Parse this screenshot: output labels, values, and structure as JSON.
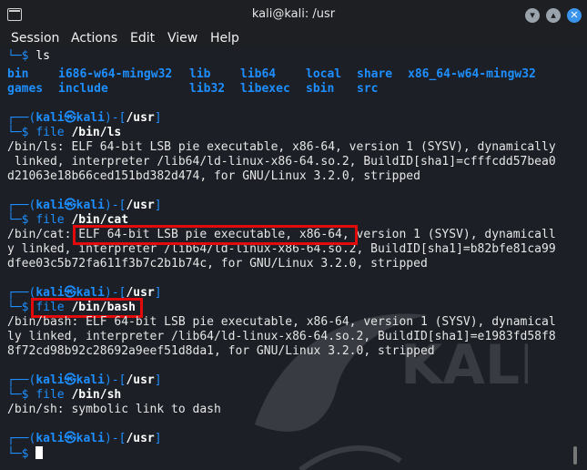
{
  "window": {
    "title": "kali@kali: /usr"
  },
  "menu": [
    "Session",
    "Actions",
    "Edit",
    "View",
    "Help"
  ],
  "ls": {
    "prompt_cont": "└─$ ",
    "cmd": "ls",
    "row1": [
      "bin",
      "i686-w64-mingw32",
      "lib",
      "lib64",
      "local",
      "share",
      "x86_64-w64-mingw32"
    ],
    "row2": [
      "games",
      "include",
      "lib32",
      "libexec",
      "sbin",
      "src"
    ]
  },
  "prompt": {
    "open": "┌──(",
    "user": "kali",
    "at": "㉿",
    "host": "kali",
    "mid": ")-[",
    "path": "/usr",
    "close": "]",
    "cont": "└─$ "
  },
  "cmd1": {
    "cmd": "file",
    "arg": "/bin/ls",
    "out": [
      "/bin/ls: ELF 64-bit LSB pie executable, x86-64, version 1 (SYSV), dynamically",
      " linked, interpreter /lib64/ld-linux-x86-64.so.2, BuildID[sha1]=cfffcdd57bea0",
      "d21063e18b66ced151bd382d474, for GNU/Linux 3.2.0, stripped"
    ]
  },
  "cmd2": {
    "cmd": "file",
    "arg": "/bin/cat",
    "out": [
      "/bin/cat: ELF 64-bit LSB pie executable, x86-64, version 1 (SYSV), dynamicall",
      "y linked, interpreter /lib64/ld-linux-x86-64.so.2, BuildID[sha1]=b82bfe81ca99",
      "dfee03c5b72fa611f3b7c2b1b74c, for GNU/Linux 3.2.0, stripped"
    ]
  },
  "cmd3": {
    "cmd": "file",
    "arg": "/bin/bash",
    "out": [
      "/bin/bash: ELF 64-bit LSB pie executable, x86-64, version 1 (SYSV), dynamical",
      "ly linked, interpreter /lib64/ld-linux-x86-64.so.2, BuildID[sha1]=e1983fd58f8",
      "8f72cd98b92c28692a9eef51d8da1, for GNU/Linux 3.2.0, stripped"
    ]
  },
  "cmd4": {
    "cmd": "file",
    "arg": "/bin/sh",
    "out": [
      "/bin/sh: symbolic link to dash"
    ]
  },
  "watermark_text": "KALI"
}
